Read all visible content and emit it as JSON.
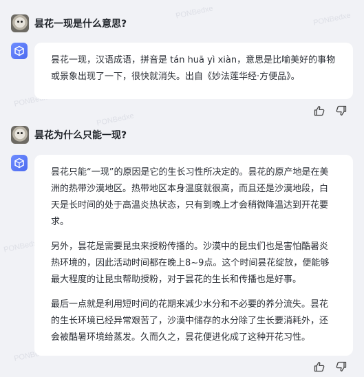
{
  "watermark_text": "PONBedxe",
  "conversation": [
    {
      "question": "昙花一现是什么意思?",
      "answer_paragraphs": [
        "昙花一现，汉语成语，拼音是 tán huā yì xiàn，意思是比喻美好的事物或景象出现了一下，很快就消失。出自《妙法莲华经·方便品》。"
      ]
    },
    {
      "question": "昙花为什么只能一现?",
      "answer_paragraphs": [
        "昙花只能“一现”的原因是它的生长习性所决定的。昙花的原产地是在美洲的热带沙漠地区。热带地区本身温度就很高，而且还是沙漠地段，白天是长时间的处于高温炎热状态，只有到晚上才会稍微降温达到开花要求。",
        "另外，昙花是需要昆虫来授粉传播的。沙漠中的昆虫们也是害怕酷暑炎热环境的，因此活动时间都在晚上8~9点。这个时间昙花绽放，便能够最大程度的让昆虫帮助授粉，对于昙花的生长和传播也是好事。",
        "最后一点就是利用短时间的花期来减少水分和不必要的养分流失。昙花的生长环境已经异常艰苦了，沙漠中储存的水分除了生长要消耗外，还会被酷暑环境给蒸发。久而久之，昙花便进化成了这种开花习性。"
      ]
    }
  ],
  "icons": {
    "user_avatar": "koala-avatar",
    "bot": "cube-bot-icon",
    "like": "thumbs-up-icon",
    "dislike": "thumbs-down-icon"
  }
}
